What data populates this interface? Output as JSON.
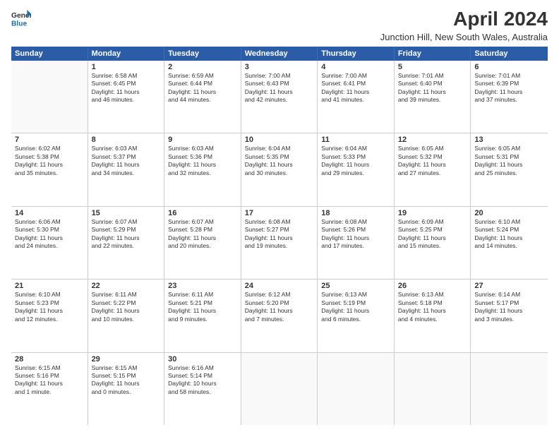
{
  "header": {
    "logo_line1": "General",
    "logo_line2": "Blue",
    "month": "April 2024",
    "location": "Junction Hill, New South Wales, Australia"
  },
  "weekdays": [
    "Sunday",
    "Monday",
    "Tuesday",
    "Wednesday",
    "Thursday",
    "Friday",
    "Saturday"
  ],
  "rows": [
    [
      {
        "day": "",
        "text": ""
      },
      {
        "day": "1",
        "text": "Sunrise: 6:58 AM\nSunset: 6:45 PM\nDaylight: 11 hours\nand 46 minutes."
      },
      {
        "day": "2",
        "text": "Sunrise: 6:59 AM\nSunset: 6:44 PM\nDaylight: 11 hours\nand 44 minutes."
      },
      {
        "day": "3",
        "text": "Sunrise: 7:00 AM\nSunset: 6:43 PM\nDaylight: 11 hours\nand 42 minutes."
      },
      {
        "day": "4",
        "text": "Sunrise: 7:00 AM\nSunset: 6:41 PM\nDaylight: 11 hours\nand 41 minutes."
      },
      {
        "day": "5",
        "text": "Sunrise: 7:01 AM\nSunset: 6:40 PM\nDaylight: 11 hours\nand 39 minutes."
      },
      {
        "day": "6",
        "text": "Sunrise: 7:01 AM\nSunset: 6:39 PM\nDaylight: 11 hours\nand 37 minutes."
      }
    ],
    [
      {
        "day": "7",
        "text": "Sunrise: 6:02 AM\nSunset: 5:38 PM\nDaylight: 11 hours\nand 35 minutes."
      },
      {
        "day": "8",
        "text": "Sunrise: 6:03 AM\nSunset: 5:37 PM\nDaylight: 11 hours\nand 34 minutes."
      },
      {
        "day": "9",
        "text": "Sunrise: 6:03 AM\nSunset: 5:36 PM\nDaylight: 11 hours\nand 32 minutes."
      },
      {
        "day": "10",
        "text": "Sunrise: 6:04 AM\nSunset: 5:35 PM\nDaylight: 11 hours\nand 30 minutes."
      },
      {
        "day": "11",
        "text": "Sunrise: 6:04 AM\nSunset: 5:33 PM\nDaylight: 11 hours\nand 29 minutes."
      },
      {
        "day": "12",
        "text": "Sunrise: 6:05 AM\nSunset: 5:32 PM\nDaylight: 11 hours\nand 27 minutes."
      },
      {
        "day": "13",
        "text": "Sunrise: 6:05 AM\nSunset: 5:31 PM\nDaylight: 11 hours\nand 25 minutes."
      }
    ],
    [
      {
        "day": "14",
        "text": "Sunrise: 6:06 AM\nSunset: 5:30 PM\nDaylight: 11 hours\nand 24 minutes."
      },
      {
        "day": "15",
        "text": "Sunrise: 6:07 AM\nSunset: 5:29 PM\nDaylight: 11 hours\nand 22 minutes."
      },
      {
        "day": "16",
        "text": "Sunrise: 6:07 AM\nSunset: 5:28 PM\nDaylight: 11 hours\nand 20 minutes."
      },
      {
        "day": "17",
        "text": "Sunrise: 6:08 AM\nSunset: 5:27 PM\nDaylight: 11 hours\nand 19 minutes."
      },
      {
        "day": "18",
        "text": "Sunrise: 6:08 AM\nSunset: 5:26 PM\nDaylight: 11 hours\nand 17 minutes."
      },
      {
        "day": "19",
        "text": "Sunrise: 6:09 AM\nSunset: 5:25 PM\nDaylight: 11 hours\nand 15 minutes."
      },
      {
        "day": "20",
        "text": "Sunrise: 6:10 AM\nSunset: 5:24 PM\nDaylight: 11 hours\nand 14 minutes."
      }
    ],
    [
      {
        "day": "21",
        "text": "Sunrise: 6:10 AM\nSunset: 5:23 PM\nDaylight: 11 hours\nand 12 minutes."
      },
      {
        "day": "22",
        "text": "Sunrise: 6:11 AM\nSunset: 5:22 PM\nDaylight: 11 hours\nand 10 minutes."
      },
      {
        "day": "23",
        "text": "Sunrise: 6:11 AM\nSunset: 5:21 PM\nDaylight: 11 hours\nand 9 minutes."
      },
      {
        "day": "24",
        "text": "Sunrise: 6:12 AM\nSunset: 5:20 PM\nDaylight: 11 hours\nand 7 minutes."
      },
      {
        "day": "25",
        "text": "Sunrise: 6:13 AM\nSunset: 5:19 PM\nDaylight: 11 hours\nand 6 minutes."
      },
      {
        "day": "26",
        "text": "Sunrise: 6:13 AM\nSunset: 5:18 PM\nDaylight: 11 hours\nand 4 minutes."
      },
      {
        "day": "27",
        "text": "Sunrise: 6:14 AM\nSunset: 5:17 PM\nDaylight: 11 hours\nand 3 minutes."
      }
    ],
    [
      {
        "day": "28",
        "text": "Sunrise: 6:15 AM\nSunset: 5:16 PM\nDaylight: 11 hours\nand 1 minute."
      },
      {
        "day": "29",
        "text": "Sunrise: 6:15 AM\nSunset: 5:15 PM\nDaylight: 11 hours\nand 0 minutes."
      },
      {
        "day": "30",
        "text": "Sunrise: 6:16 AM\nSunset: 5:14 PM\nDaylight: 10 hours\nand 58 minutes."
      },
      {
        "day": "",
        "text": ""
      },
      {
        "day": "",
        "text": ""
      },
      {
        "day": "",
        "text": ""
      },
      {
        "day": "",
        "text": ""
      }
    ]
  ]
}
